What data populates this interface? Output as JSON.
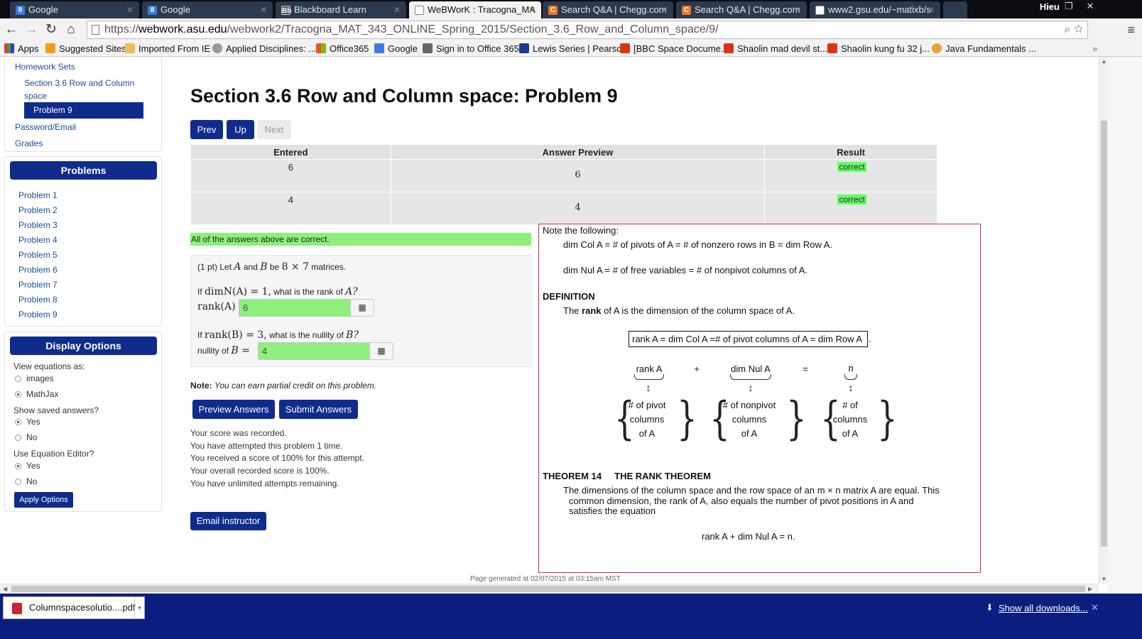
{
  "browser": {
    "tabs": [
      {
        "title": "Google",
        "icon": "google-icon"
      },
      {
        "title": "Google",
        "icon": "google-icon"
      },
      {
        "title": "Blackboard Learn",
        "icon": "blackboard-icon"
      },
      {
        "title": "WeBWorK : Tracogna_MA",
        "icon": "page-icon"
      },
      {
        "title": "Search Q&A | Chegg.com",
        "icon": "chegg-icon"
      },
      {
        "title": "Search Q&A | Chegg.com",
        "icon": "chegg-icon"
      },
      {
        "title": "www2.gsu.edu/~matixb/s",
        "icon": "page-icon"
      }
    ],
    "user": "Hieu",
    "url_prefix": "https://",
    "url_host": "webwork.asu.edu",
    "url_path": "/webwork2/Tracogna_MAT_343_ONLINE_Spring_2015/Section_3.6_Row_and_Column_space/9/",
    "bookmarks": [
      "Apps",
      "Suggested Sites",
      "Imported From IE",
      "Applied Disciplines: ...",
      "Office365",
      "Google",
      "Sign in to Office 365",
      "Lewis Series | Pearson",
      "[BBC Space Docume...",
      "Shaolin mad devil st...",
      "Shaolin kung fu 32 j...",
      "Java Fundamentals ..."
    ]
  },
  "sidebar": {
    "homework_sets": "Homework Sets",
    "section_link": "Section 3.6 Row and Column space",
    "current_problem": "Problem 9",
    "password_email": "Password/Email",
    "grades": "Grades",
    "problems_header": "Problems",
    "problems": [
      "Problem 1",
      "Problem 2",
      "Problem 3",
      "Problem 4",
      "Problem 5",
      "Problem 6",
      "Problem 7",
      "Problem 8",
      "Problem 9"
    ],
    "display_options_header": "Display Options",
    "view_equations_label": "View equations as:",
    "view_equations_options": [
      "images",
      "MathJax"
    ],
    "show_saved_label": "Show saved answers?",
    "show_saved_options": [
      "Yes",
      "No"
    ],
    "use_editor_label": "Use Equation Editor?",
    "use_editor_options": [
      "Yes",
      "No"
    ],
    "apply_button": "Apply Options"
  },
  "main": {
    "title": "Section 3.6 Row and Column space: Problem 9",
    "nav": {
      "prev": "Prev",
      "up": "Up",
      "next": "Next"
    },
    "table": {
      "headers": [
        "Entered",
        "Answer Preview",
        "Result"
      ],
      "rows": [
        {
          "entered": "6",
          "preview": "6",
          "result": "correct"
        },
        {
          "entered": "4",
          "preview": "4",
          "result": "correct"
        }
      ]
    },
    "all_correct": "All of the answers above are correct.",
    "problem": {
      "points": "(1 pt) Let",
      "var_a": "A",
      "and": "and",
      "var_b": "B",
      "be": "be",
      "dims": "8 × 7",
      "matrices": "matrices.",
      "q1_if": "If",
      "q1_expr": "dimN(A) = 1,",
      "q1_text": "what is the rank of",
      "q1_var": "A?",
      "q1_label": "rank(A)",
      "q1_value": "6",
      "q2_if": "If",
      "q2_expr": "rank(B) = 3,",
      "q2_text": "what is the nullity of",
      "q2_var": "B?",
      "q2_label": "nullity of",
      "q2_label_var": "B =",
      "q2_value": "4"
    },
    "note_label": "Note:",
    "note_text": "You can earn partial credit on this problem.",
    "preview_button": "Preview Answers",
    "submit_button": "Submit Answers",
    "score_lines": [
      "Your score was recorded.",
      "You have attempted this problem 1 time.",
      "You received a score of 100% for this attempt.",
      "Your overall recorded score is 100%.",
      "You have unlimited attempts remaining."
    ],
    "email_button": "Email instructor",
    "footer": "Page generated at 02/07/2015 at 03:15am MST"
  },
  "note_panel": {
    "heading": "Note the following:",
    "line1": "dim Col A = # of pivots of A = # of nonzero rows in B = dim Row A.",
    "line2": "dim Nul A = # of free variables = # of nonpivot columns of A.",
    "definition_heading": "DEFINITION",
    "definition_pre": "The",
    "definition_bold": "rank",
    "definition_post": "of A is the dimension of the column space of A.",
    "boxed": "rank A = dim Col A =# of pivot columns of A = dim Row A",
    "diagram": {
      "term1": "rank A",
      "plus": "+",
      "term2": "dim Nul A",
      "equals": "=",
      "term3": "n",
      "cell1": [
        "# of pivot",
        "columns",
        "of A"
      ],
      "cell2": [
        "# of nonpivot",
        "columns",
        "of A"
      ],
      "cell3": [
        "# of",
        "columns",
        "of A"
      ]
    },
    "theorem_heading": "THEOREM 14",
    "theorem_title": "THE RANK THEOREM",
    "theorem_line1": "The dimensions of the column space and the row space of an m × n matrix A are equal.  This",
    "theorem_line2": "common dimension, the rank of A, also equals the number of pivot positions in A and",
    "theorem_line3": "satisfies the equation",
    "equation": "rank A + dim Nul A = n."
  },
  "downloads": {
    "file_name": "Columnspacesolutio....pdf",
    "show_all": "Show all downloads..."
  },
  "colors": {
    "webwork_blue": "#0f2c8c",
    "correct_green": "#8cf07a",
    "panel_border": "#c8343c",
    "download_bar": "#0b1e80"
  }
}
